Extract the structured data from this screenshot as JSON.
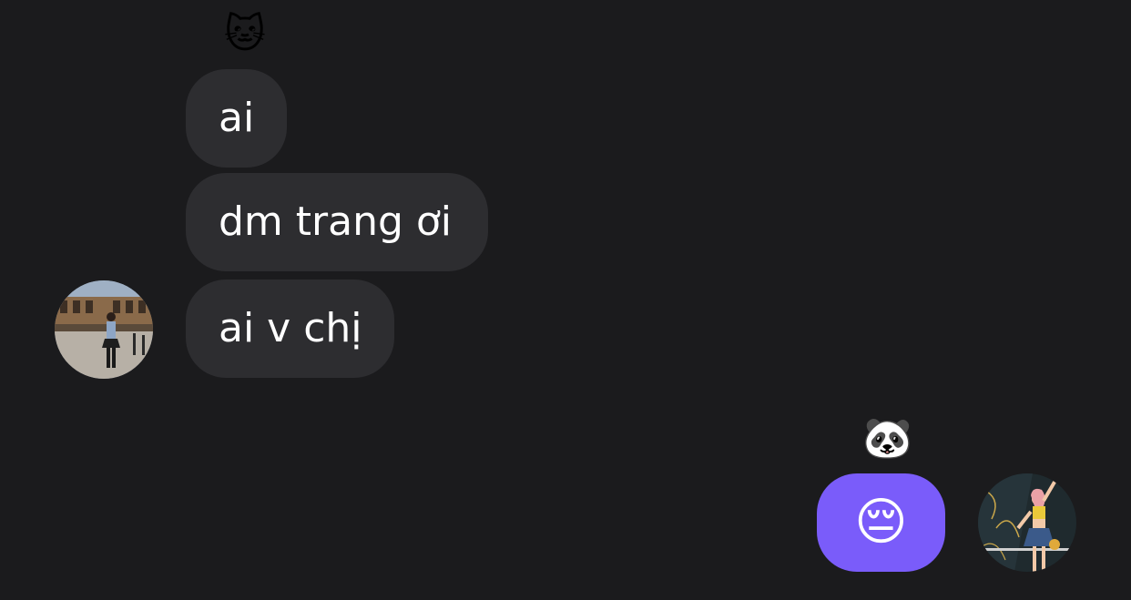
{
  "incoming": {
    "reaction_emoji": "🐱",
    "messages": [
      {
        "text": "ai"
      },
      {
        "text": "dm trang ơi"
      },
      {
        "text": "ai v chị"
      }
    ],
    "avatar_icon": "street-photo-avatar"
  },
  "outgoing": {
    "reaction_emoji": "🐼",
    "messages": [
      {
        "text": "😔"
      }
    ],
    "avatar_icon": "dance-photo-avatar"
  },
  "colors": {
    "background": "#1b1b1d",
    "incoming_bubble": "#2d2d30",
    "outgoing_bubble": "#7a5cfa",
    "text": "#ffffff"
  }
}
